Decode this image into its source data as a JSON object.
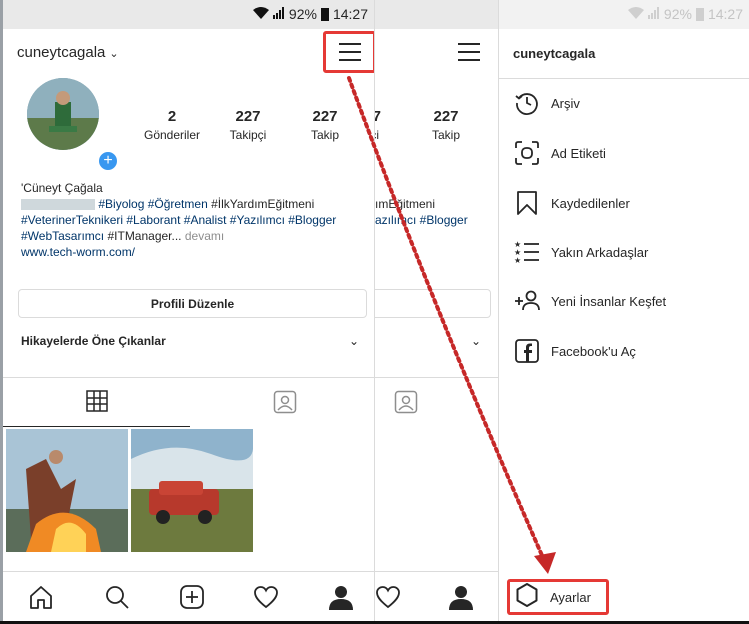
{
  "status": {
    "battery": "92%",
    "time": "14:27"
  },
  "profile": {
    "username": "cuneytcagala",
    "stats": [
      {
        "value": "2",
        "label": "Gönderiler"
      },
      {
        "value": "227",
        "label": "Takipçi"
      },
      {
        "value": "227",
        "label": "Takip"
      }
    ],
    "bio_name": "'Cüneyt Çağala",
    "bio_line1_tags": "#Biyolog #Öğretmen",
    "bio_line1_rest": " #İlkYardımEğitmeni",
    "bio_line2": "#VeterinerTeknikeri #Laborant #Analist #Yazılımcı #Blogger",
    "bio_line3_tag": "#WebTasarımcı",
    "bio_line3_rest": " #ITManager...",
    "bio_more": " devamı",
    "website": "www.tech-worm.com/",
    "edit_button": "Profili Düzenle",
    "highlights_label": "Hikayelerde Öne Çıkanlar"
  },
  "middle": {
    "stat_value": "227",
    "stat_label": "Takip",
    "stat_label_cut": "çi",
    "stat_num_cut": "7",
    "bio_line1": "ımEğitmeni",
    "bio_line2": "azılımcı #Blogger"
  },
  "drawer": {
    "username": "cuneytcagala",
    "items": [
      {
        "label": "Arşiv",
        "icon": "archive-clock-icon"
      },
      {
        "label": "Ad Etiketi",
        "icon": "nametag-icon"
      },
      {
        "label": "Kaydedilenler",
        "icon": "bookmark-icon"
      },
      {
        "label": "Yakın Arkadaşlar",
        "icon": "close-friends-list-icon"
      },
      {
        "label": "Yeni İnsanlar Keşfet",
        "icon": "discover-people-icon"
      },
      {
        "label": "Facebook'u Aç",
        "icon": "facebook-icon"
      }
    ],
    "settings_label": "Ayarlar"
  },
  "colors": {
    "highlight": "#e53935",
    "link": "#003569",
    "accent": "#3897f0"
  }
}
